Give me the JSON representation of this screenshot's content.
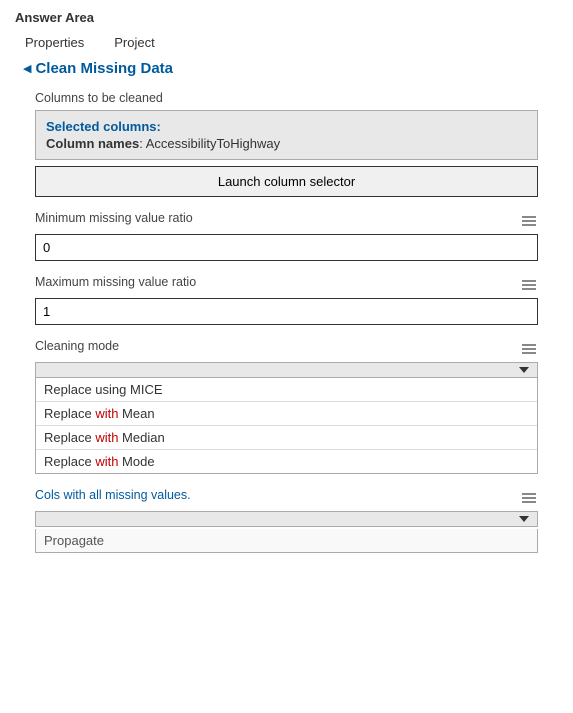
{
  "answerArea": {
    "title": "Answer Area",
    "nav": {
      "properties": "Properties",
      "project": "Project"
    }
  },
  "section": {
    "arrow": "◄",
    "title": "Clean Missing Data"
  },
  "fields": {
    "columnsLabel": "Columns to be cleaned",
    "selectedColumns": {
      "title": "Selected columns:",
      "columnNamesLabel": "Column names",
      "columnNamesValue": "AccessibilityToHighway"
    },
    "launchButtonLabel": "Launch column selector",
    "minMissingLabel": "Minimum missing value ratio",
    "minMissingValue": "0",
    "maxMissingLabel": "Maximum missing value ratio",
    "maxMissingValue": "1",
    "cleaningModeLabel": "Cleaning mode",
    "cleaningModeOptions": [
      "Replace using MICE",
      "Replace with Mean",
      "Replace with Median",
      "Replace with Mode"
    ],
    "colsMissingLabel": "Cols with all missing values.",
    "propagateText": "Propagate"
  }
}
